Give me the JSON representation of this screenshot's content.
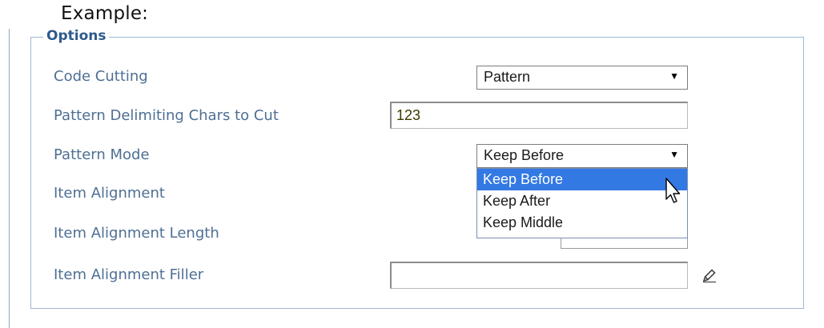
{
  "heading": "Example:",
  "fieldset": {
    "legend": "Options"
  },
  "fields": {
    "code_cutting": {
      "label": "Code Cutting",
      "value": "Pattern"
    },
    "pattern_chars": {
      "label": "Pattern Delimiting Chars to Cut",
      "value": "123"
    },
    "pattern_mode": {
      "label": "Pattern Mode",
      "value": "Keep Before"
    },
    "item_alignment": {
      "label": "Item Alignment"
    },
    "item_alignment_length": {
      "label": "Item Alignment Length"
    },
    "item_alignment_filler": {
      "label": "Item Alignment Filler",
      "value": ""
    }
  },
  "dropdown": {
    "options": [
      "Keep Before",
      "Keep After",
      "Keep Middle"
    ],
    "highlighted_index": 0
  },
  "icons": {
    "arrow": "▼",
    "pencil": "pencil-icon",
    "cursor": "mouse-pointer-icon"
  },
  "colors": {
    "label": "#4e6f94",
    "legend": "#2d5b8c",
    "border": "#9cb6d4",
    "highlight": "#3379e3"
  }
}
